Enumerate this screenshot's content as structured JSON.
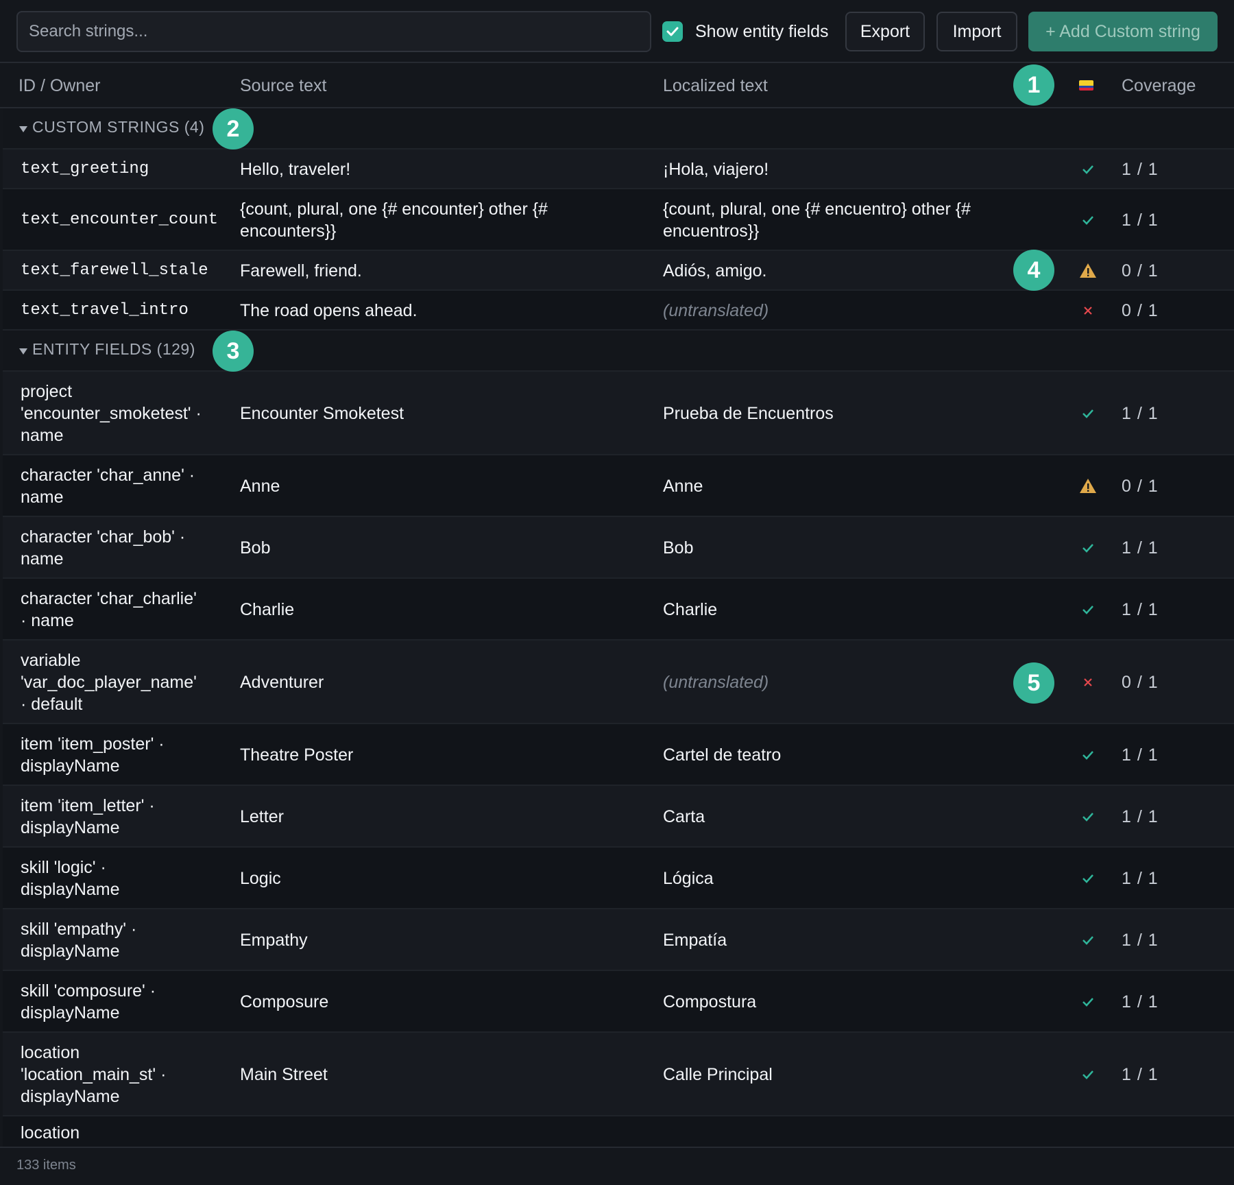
{
  "toolbar": {
    "search_placeholder": "Search strings...",
    "show_entity_fields_label": "Show entity fields",
    "show_entity_fields_checked": true,
    "export_label": "Export",
    "import_label": "Import",
    "add_label": "+ Add Custom string"
  },
  "columns": {
    "id_owner": "ID / Owner",
    "source": "Source text",
    "localized": "Localized text",
    "locale_flag": "colombia-flag-icon",
    "coverage": "Coverage"
  },
  "groups": {
    "custom": "CUSTOM STRINGS (4)",
    "entity": "ENTITY FIELDS (129)"
  },
  "custom_rows": [
    {
      "id": "text_greeting",
      "source": "Hello, traveler!",
      "localized": "¡Hola, viajero!",
      "status": "ok",
      "coverage": "1 / 1"
    },
    {
      "id": "text_encounter_count",
      "source": "{count, plural, one {# encounter} other {# encounters}}",
      "localized": "{count, plural, one {# encuentro} other {# encuentros}}",
      "status": "ok",
      "coverage": "1 / 1"
    },
    {
      "id": "text_farewell_stale",
      "source": "Farewell, friend.",
      "localized": "Adiós, amigo.",
      "status": "stale",
      "coverage": "0 / 1"
    },
    {
      "id": "text_travel_intro",
      "source": "The road opens ahead.",
      "localized": "(untranslated)",
      "status": "missing",
      "coverage": "0 / 1"
    }
  ],
  "entity_rows": [
    {
      "owner": "project 'encounter_smoketest' · name",
      "source": "Encounter Smoketest",
      "localized": "Prueba de Encuentros",
      "status": "ok",
      "coverage": "1 / 1"
    },
    {
      "owner": "character 'char_anne' · name",
      "source": "Anne",
      "localized": "Anne",
      "status": "stale",
      "coverage": "0 / 1"
    },
    {
      "owner": "character 'char_bob' · name",
      "source": "Bob",
      "localized": "Bob",
      "status": "ok",
      "coverage": "1 / 1"
    },
    {
      "owner": "character 'char_charlie' · name",
      "source": "Charlie",
      "localized": "Charlie",
      "status": "ok",
      "coverage": "1 / 1"
    },
    {
      "owner": "variable 'var_doc_player_name' · default",
      "source": "Adventurer",
      "localized": "(untranslated)",
      "status": "missing",
      "coverage": "0 / 1"
    },
    {
      "owner": "item 'item_poster' · displayName",
      "source": "Theatre Poster",
      "localized": "Cartel de teatro",
      "status": "ok",
      "coverage": "1 / 1"
    },
    {
      "owner": "item 'item_letter' · displayName",
      "source": "Letter",
      "localized": "Carta",
      "status": "ok",
      "coverage": "1 / 1"
    },
    {
      "owner": "skill 'logic' · displayName",
      "source": "Logic",
      "localized": "Lógica",
      "status": "ok",
      "coverage": "1 / 1"
    },
    {
      "owner": "skill 'empathy' · displayName",
      "source": "Empathy",
      "localized": "Empatía",
      "status": "ok",
      "coverage": "1 / 1"
    },
    {
      "owner": "skill 'composure' · displayName",
      "source": "Composure",
      "localized": "Compostura",
      "status": "ok",
      "coverage": "1 / 1"
    },
    {
      "owner": "location 'location_main_st' · displayName",
      "source": "Main Street",
      "localized": "Calle Principal",
      "status": "ok",
      "coverage": "1 / 1"
    },
    {
      "owner": "location",
      "source": "",
      "localized": "",
      "status": "",
      "coverage": ""
    }
  ],
  "badges": [
    "1",
    "2",
    "3",
    "4",
    "5"
  ],
  "footer": {
    "count": "133 items"
  },
  "colors": {
    "accent": "#36b497",
    "ok": "#2fb59a",
    "warn": "#e0a94a",
    "error": "#e5484d"
  }
}
